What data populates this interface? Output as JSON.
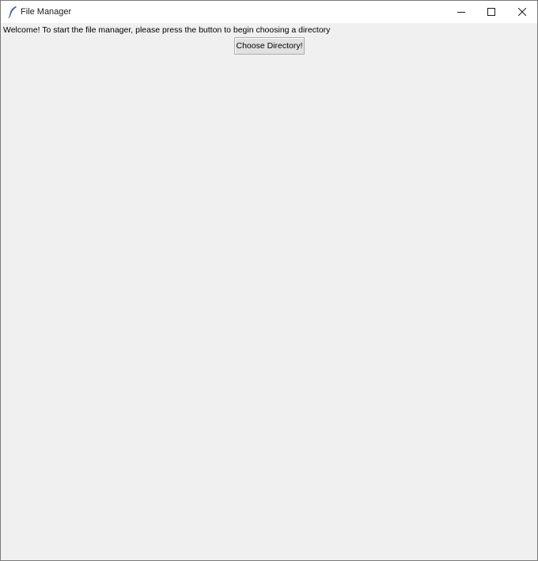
{
  "window": {
    "title": "File Manager",
    "controls": {
      "minimize": "minimize-icon",
      "maximize": "maximize-icon",
      "close": "close-icon"
    }
  },
  "main": {
    "welcome_text": "Welcome! To start the file manager, please press the button to begin choosing a directory",
    "choose_button_label": "Choose Directory!"
  },
  "colors": {
    "titlebar": "#ffffff",
    "client_background": "#f0f0f0",
    "button_face": "#e1e1e1",
    "button_border": "#adadad",
    "window_border": "#7a7a7a"
  }
}
